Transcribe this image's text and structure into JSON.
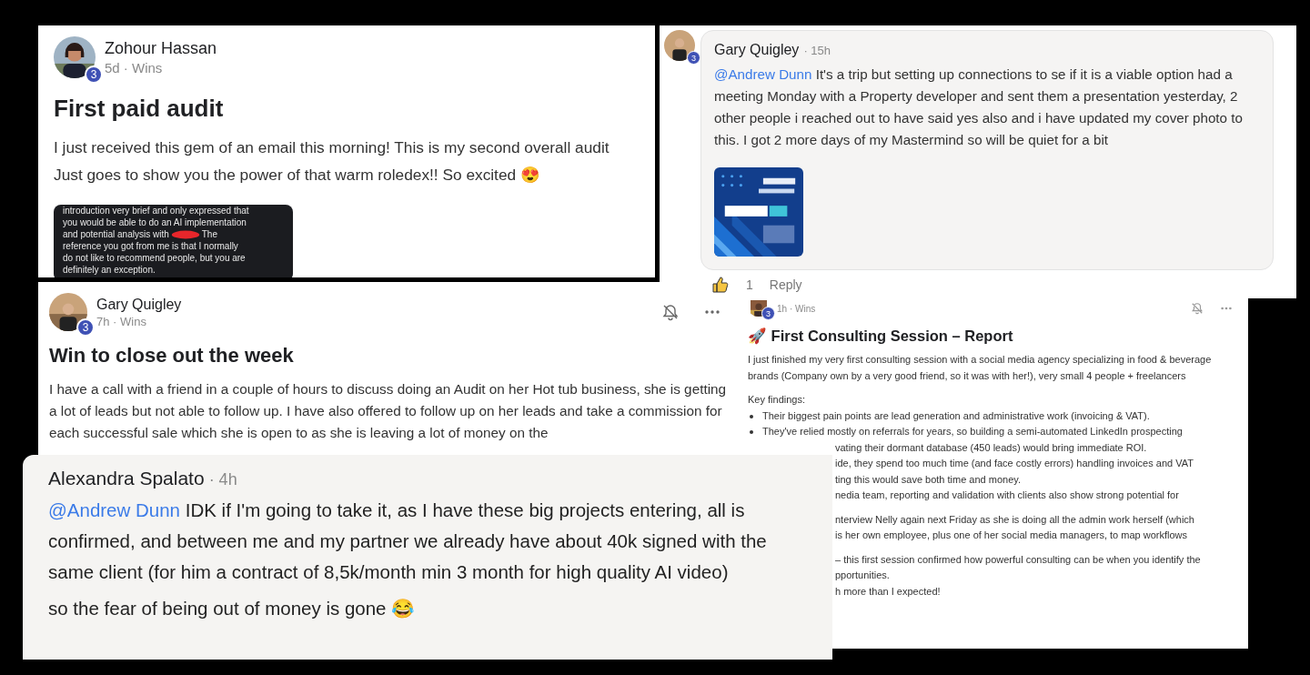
{
  "audit_post": {
    "author": "Zohour Hassan",
    "badge": "3",
    "time": "5d",
    "separator": "·",
    "category": "Wins",
    "title": "First paid audit",
    "paragraphs": [
      "I just received this gem of an email this morning! This is my second overall audit",
      "Just goes to show you the power of that warm roledex!! So excited 😍"
    ],
    "email_lines": [
      "introduction very brief and only expressed that",
      "you would be able to do an AI implementation",
      "and potential analysis with",
      "The",
      "reference you got from me is that I normally",
      "do not like to recommend people, but you are",
      "definitely an exception."
    ]
  },
  "comment_top": {
    "author": "Gary Quigley",
    "badge": "3",
    "separator": "·",
    "time": "15h",
    "mention": "@Andrew Dunn",
    "text": "It's a trip but setting up connections to se if it is a viable option had a meeting Monday with a Property developer and sent them a presentation yesterday, 2 other people i reached out to have said yes also and i have updated my cover photo to this. I got 2 more days of my Mastermind so will be quiet for a bit",
    "likes": "1",
    "reply": "Reply"
  },
  "report_post": {
    "badge": "3",
    "time": "1h",
    "separator": "·",
    "category": "Wins",
    "title": "🚀 First Consulting Session – Report",
    "blocks": [
      [
        {
          "kind": "text",
          "text": "I just finished my very first consulting session with a social media agency specializing in food & beverage brands (Company own by a very good friend, so it was with her!), very small 4 people + freelancers"
        }
      ],
      [
        {
          "kind": "text",
          "text": "Key findings:"
        },
        {
          "kind": "bullet",
          "text": "Their biggest pain points are lead generation and administrative work (invoicing & VAT)."
        },
        {
          "kind": "bullet",
          "text": "They've relied mostly on referrals for years, so building a semi-automated LinkedIn prospecting"
        },
        {
          "kind": "partial",
          "text": "vating their dormant database (450 leads) would bring immediate ROI."
        },
        {
          "kind": "partial",
          "text": "ide, they spend too much time (and face costly errors) handling invoices and VAT"
        },
        {
          "kind": "partial",
          "text": "ting this would save both time and money."
        },
        {
          "kind": "partial",
          "text": "nedia team, reporting and validation with clients also show strong potential for"
        }
      ],
      [
        {
          "kind": "partial",
          "text": "nterview Nelly again next Friday as she is doing all the admin work herself (which"
        },
        {
          "kind": "partial",
          "text": "is her own employee, plus one of her social media managers, to map workflows"
        }
      ],
      [
        {
          "kind": "partial",
          "text": "– this first session confirmed how powerful consulting can be when you identify the"
        },
        {
          "kind": "partial",
          "text": "pportunities."
        },
        {
          "kind": "partial",
          "text": "h more than I expected!"
        }
      ]
    ]
  },
  "week_post": {
    "author": "Gary Quigley",
    "badge": "3",
    "time": "7h",
    "separator": "·",
    "category": "Wins",
    "title": "Win to close out the week",
    "body": "I have a call with a friend in a couple of hours to discuss doing an Audit on her Hot tub business, she is getting a lot of leads but not able to follow up. I have also offered to follow up on her leads and take a commission for each successful sale which she is open to as she is leaving a lot of money on the"
  },
  "comment_bottom": {
    "author": "Alexandra Spalato",
    "separator": "·",
    "time": "4h",
    "mention": "@Andrew Dunn",
    "paragraphs": [
      "IDK if I'm going to take it, as I have these big projects entering, all is confirmed, and between me and my partner we already have about 40k signed with the same client (for him a contract of 8,5k/month min 3 month for high quality AI video)",
      "so the fear of being out of money is gone 😂"
    ]
  }
}
